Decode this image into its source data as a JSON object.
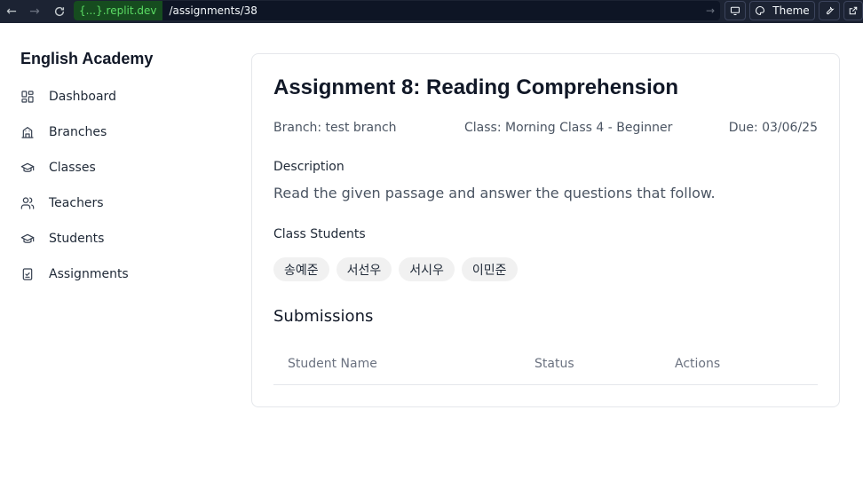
{
  "browser": {
    "url_domain": "{...}.replit.dev",
    "url_path": "/assignments/38",
    "theme_label": "Theme"
  },
  "sidebar": {
    "brand": "English Academy",
    "items": [
      {
        "label": "Dashboard",
        "icon": "dashboard-icon"
      },
      {
        "label": "Branches",
        "icon": "building-icon"
      },
      {
        "label": "Classes",
        "icon": "graduation-cap-icon"
      },
      {
        "label": "Teachers",
        "icon": "users-icon"
      },
      {
        "label": "Students",
        "icon": "graduation-cap-icon"
      },
      {
        "label": "Assignments",
        "icon": "clipboard-check-icon"
      }
    ]
  },
  "assignment": {
    "title": "Assignment 8: Reading Comprehension",
    "branch": "Branch: test branch",
    "class": "Class: Morning Class 4 - Beginner",
    "due": "Due: 03/06/25",
    "description_label": "Description",
    "description": "Read the given passage and answer the questions that follow.",
    "students_label": "Class Students",
    "students": [
      "송예준",
      "서선우",
      "서시우",
      "이민준"
    ]
  },
  "submissions": {
    "title": "Submissions",
    "columns": [
      "Student Name",
      "Status",
      "Actions"
    ]
  }
}
